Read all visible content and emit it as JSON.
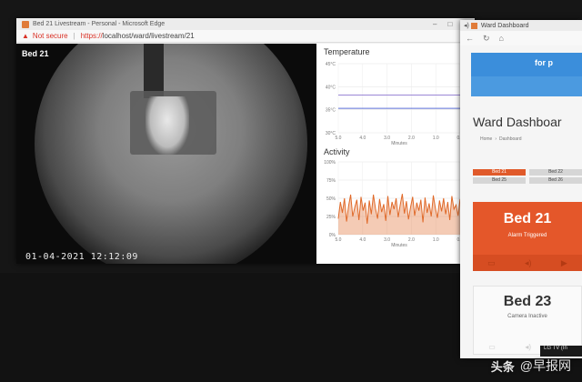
{
  "main_window": {
    "title": "Bed 21 Livestream - Personal - Microsoft Edge",
    "address": {
      "security_label": "Not secure",
      "url_protocol": "https://",
      "url_rest": "localhost/ward/livestream/21"
    },
    "feed": {
      "bed_label": "Bed 21",
      "timestamp": "01-04-2021 12:12:09"
    },
    "charts": {
      "temperature_title": "Temperature",
      "activity_title": "Activity"
    }
  },
  "chart_data": [
    {
      "type": "line",
      "title": "Temperature",
      "xlabel": "Minutes",
      "x_ticks": [
        "5.0",
        "4.0",
        "3.0",
        "2.0",
        "1.0",
        "0.0"
      ],
      "y_ticks": [
        "45°C",
        "40°C",
        "35°C",
        "30°C"
      ],
      "ylim": [
        30,
        45
      ],
      "xlim": [
        5.0,
        0.0
      ],
      "grid": true,
      "series": [
        {
          "color": "#9b87d6",
          "values": [
            38.2,
            38.2
          ]
        },
        {
          "color": "#5b6fd6",
          "values": [
            35.3,
            35.3
          ]
        }
      ],
      "x": [
        5.0,
        0.0
      ]
    },
    {
      "type": "area",
      "title": "Activity",
      "xlabel": "Minutes",
      "x_ticks": [
        "5.0",
        "4.0",
        "3.0",
        "2.0",
        "1.0",
        "0.0"
      ],
      "y_ticks": [
        "100%",
        "75%",
        "50%",
        "25%",
        "0%"
      ],
      "ylim": [
        0,
        100
      ],
      "xlim": [
        5.0,
        0.0
      ],
      "grid": true,
      "series": [
        {
          "color": "#e06a2a",
          "values": [
            22,
            45,
            30,
            50,
            18,
            40,
            55,
            25,
            38,
            48,
            20,
            52,
            33,
            44,
            15,
            47,
            28,
            55,
            36,
            22,
            49,
            31,
            42,
            19,
            53,
            27,
            45,
            35,
            50,
            24,
            41,
            56,
            29,
            46,
            21,
            38,
            52,
            26,
            44,
            33,
            48,
            17,
            51,
            30,
            43,
            25,
            54,
            37,
            23,
            47,
            32,
            50,
            28,
            45,
            20,
            53,
            35,
            41,
            26,
            49
          ]
        }
      ]
    }
  ],
  "dashboard_window": {
    "title": "Ward Dashboard",
    "banner_text": "for p",
    "heading": "Ward Dashboar",
    "breadcrumb": [
      "Home",
      "Dashboard"
    ],
    "bed_grid": [
      [
        "Bed 21",
        "Bed 22"
      ],
      [
        "Bed 25",
        "Bed 26"
      ]
    ],
    "alarm_card": {
      "bed": "Bed 21",
      "status": "Alarm Triggered"
    },
    "inactive_card": {
      "bed": "Bed 23",
      "status": "Camera Inactive"
    }
  },
  "taskbar_text": "LG TV (In",
  "watermark": {
    "logo": "头条",
    "text": "@早报网"
  }
}
